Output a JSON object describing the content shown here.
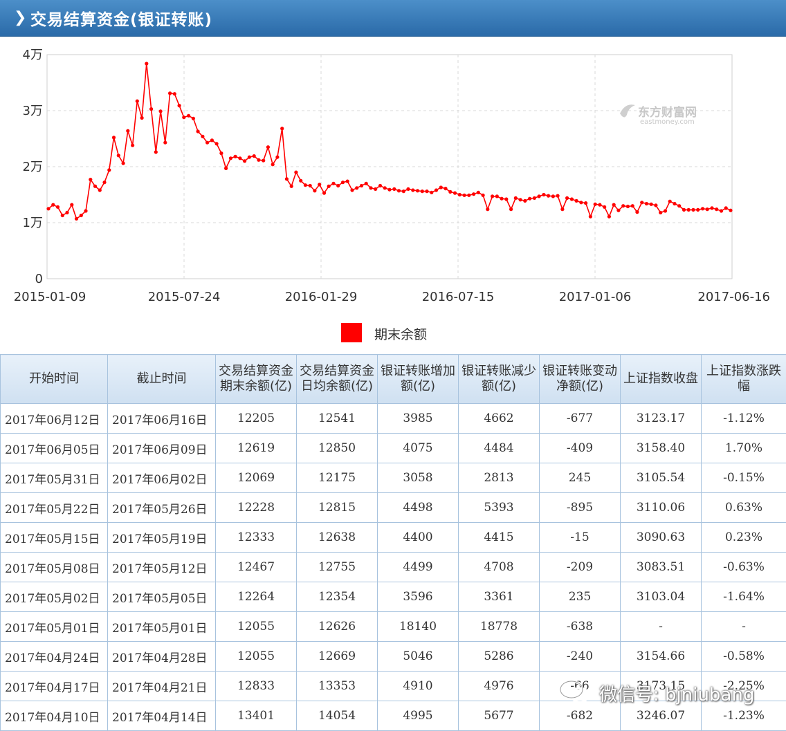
{
  "header": {
    "title": "交易结算资金(银证转账)"
  },
  "chart_data": {
    "type": "line",
    "ylim": [
      0,
      40000
    ],
    "y_ticks": [
      "0",
      "1万",
      "2万",
      "3万",
      "4万"
    ],
    "x_ticks": [
      "2015-01-09",
      "2015-07-24",
      "2016-01-29",
      "2016-07-15",
      "2017-01-06",
      "2017-06-16"
    ],
    "series": [
      {
        "name": "期末余额",
        "color": "#ff0000",
        "values": [
          12500,
          13200,
          12800,
          11300,
          11800,
          13200,
          10700,
          11300,
          12100,
          17700,
          16500,
          15800,
          17200,
          19400,
          25200,
          22000,
          20600,
          26400,
          23800,
          31700,
          28700,
          38400,
          30300,
          22600,
          29900,
          24300,
          33100,
          33000,
          30900,
          28800,
          29100,
          28600,
          26300,
          25400,
          24300,
          24700,
          24100,
          22400,
          19700,
          21500,
          21800,
          21500,
          21000,
          21700,
          21900,
          21200,
          21100,
          23500,
          20400,
          21700,
          26800,
          17800,
          16500,
          19000,
          17500,
          16700,
          16600,
          15700,
          16800,
          15300,
          16500,
          17000,
          16600,
          17200,
          17400,
          15800,
          16200,
          16600,
          17000,
          16200,
          16000,
          16600,
          16200,
          15900,
          16000,
          15700,
          15600,
          16000,
          15800,
          15700,
          15600,
          15600,
          15400,
          15800,
          16300,
          16100,
          15500,
          15300,
          15000,
          14900,
          14900,
          15100,
          15400,
          14900,
          12400,
          14700,
          14700,
          14300,
          14200,
          12400,
          14400,
          14100,
          13900,
          14300,
          14400,
          14700,
          15000,
          14800,
          14700,
          14800,
          12400,
          14400,
          14200,
          13900,
          13600,
          13500,
          11100,
          13300,
          13200,
          12800,
          11100,
          13200,
          12200,
          13000,
          12900,
          13000,
          11900,
          13600,
          13400,
          13300,
          13100,
          11800,
          12100,
          13800,
          13400,
          13000,
          12300,
          12300,
          12300,
          12300,
          12500,
          12400,
          12600,
          12400,
          12100,
          12600,
          12200
        ]
      }
    ],
    "legend": "bottom-center"
  },
  "watermark": {
    "logo_text": "东方财富网",
    "logo_sub": "eastmoney.com"
  },
  "table": {
    "headers": [
      "开始时间",
      "截止时间",
      "交易结算资金期末余额(亿)",
      "交易结算资金日均余额(亿)",
      "银证转账增加额(亿)",
      "银证转账减少额(亿)",
      "银证转账变动净额(亿)",
      "上证指数收盘",
      "上证指数涨跌幅"
    ],
    "rows": [
      [
        "2017年06月12日",
        "2017年06月16日",
        "12205",
        "12541",
        "3985",
        "4662",
        "-677",
        "3123.17",
        "-1.12%"
      ],
      [
        "2017年06月05日",
        "2017年06月09日",
        "12619",
        "12850",
        "4075",
        "4484",
        "-409",
        "3158.40",
        "1.70%"
      ],
      [
        "2017年05月31日",
        "2017年06月02日",
        "12069",
        "12175",
        "3058",
        "2813",
        "245",
        "3105.54",
        "-0.15%"
      ],
      [
        "2017年05月22日",
        "2017年05月26日",
        "12228",
        "12815",
        "4498",
        "5393",
        "-895",
        "3110.06",
        "0.63%"
      ],
      [
        "2017年05月15日",
        "2017年05月19日",
        "12333",
        "12638",
        "4400",
        "4415",
        "-15",
        "3090.63",
        "0.23%"
      ],
      [
        "2017年05月08日",
        "2017年05月12日",
        "12467",
        "12755",
        "4499",
        "4708",
        "-209",
        "3083.51",
        "-0.63%"
      ],
      [
        "2017年05月02日",
        "2017年05月05日",
        "12264",
        "12354",
        "3596",
        "3361",
        "235",
        "3103.04",
        "-1.64%"
      ],
      [
        "2017年05月01日",
        "2017年05月01日",
        "12055",
        "12626",
        "18140",
        "18778",
        "-638",
        "-",
        "-"
      ],
      [
        "2017年04月24日",
        "2017年04月28日",
        "12055",
        "12669",
        "5046",
        "5286",
        "-240",
        "3154.66",
        "-0.58%"
      ],
      [
        "2017年04月17日",
        "2017年04月21日",
        "12833",
        "13353",
        "4910",
        "4976",
        "-66",
        "3173.15",
        "-2.25%"
      ],
      [
        "2017年04月10日",
        "2017年04月14日",
        "13401",
        "14054",
        "4995",
        "5677",
        "-682",
        "3246.07",
        "-1.23%"
      ]
    ]
  },
  "overlay": {
    "wechat_text": "微信号: bjniubang"
  }
}
